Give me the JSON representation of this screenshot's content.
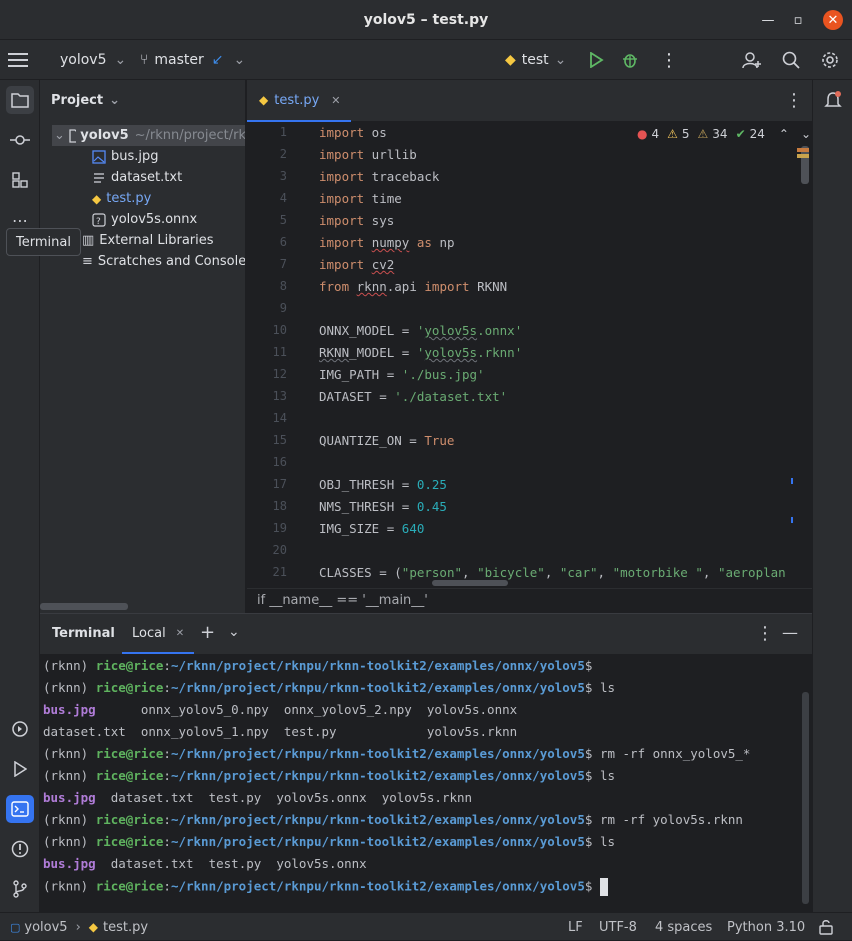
{
  "window": {
    "title": "yolov5 – test.py"
  },
  "toolbar": {
    "project": "yolov5",
    "branch": "master",
    "run_config": "test"
  },
  "project_panel": {
    "title": "Project",
    "root": {
      "name": "yolov5",
      "path": "~/rknn/project/rk"
    },
    "files": [
      {
        "name": "bus.jpg",
        "icon": "image-icon"
      },
      {
        "name": "dataset.txt",
        "icon": "text-file-icon"
      },
      {
        "name": "test.py",
        "icon": "python-icon"
      },
      {
        "name": "yolov5s.onnx",
        "icon": "unknown-file-icon"
      }
    ],
    "external_libraries": "External Libraries",
    "scratches": "Scratches and Consoles"
  },
  "tooltip": {
    "text": "Terminal"
  },
  "editor": {
    "tab": "test.py",
    "inspections": {
      "errors": "4",
      "warnings": "5",
      "weak_warnings": "34",
      "ok": "24"
    },
    "lines": [
      "1",
      "2",
      "3",
      "4",
      "5",
      "6",
      "7",
      "8",
      "9",
      "10",
      "11",
      "12",
      "13",
      "14",
      "15",
      "16",
      "17",
      "18",
      "19",
      "20",
      "21"
    ],
    "breadcrumb": "if __name__ == '__main__'"
  },
  "terminal": {
    "tab_title": "Terminal",
    "local_tab": "Local",
    "env": "(rknn)",
    "user": "rice@rice",
    "path": "~/rknn/project/rknpu/rknn-toolkit2/examples/onnx/yolov5",
    "cmd_ls": "ls",
    "cmd_rm1": "rm -rf onnx_yolov5_*",
    "cmd_rm2": "rm -rf yolov5s.rknn",
    "ls1_row1": [
      "bus.jpg",
      "onnx_yolov5_0.npy",
      "onnx_yolov5_2.npy",
      "yolov5s.onnx"
    ],
    "ls1_row2": [
      "dataset.txt",
      "onnx_yolov5_1.npy",
      "test.py",
      "yolov5s.rknn"
    ],
    "ls2": [
      "bus.jpg",
      "dataset.txt",
      "test.py",
      "yolov5s.onnx",
      "yolov5s.rknn"
    ],
    "ls3": [
      "bus.jpg",
      "dataset.txt",
      "test.py",
      "yolov5s.onnx"
    ]
  },
  "statusbar": {
    "project": "yolov5",
    "file": "test.py",
    "line_sep": "LF",
    "encoding": "UTF-8",
    "indent": "4 spaces",
    "interpreter": "Python 3.10"
  },
  "colors": {
    "accent": "#3574f0",
    "close": "#e95420",
    "prompt_user": "#5fb35f",
    "prompt_path": "#5a9bd5"
  }
}
